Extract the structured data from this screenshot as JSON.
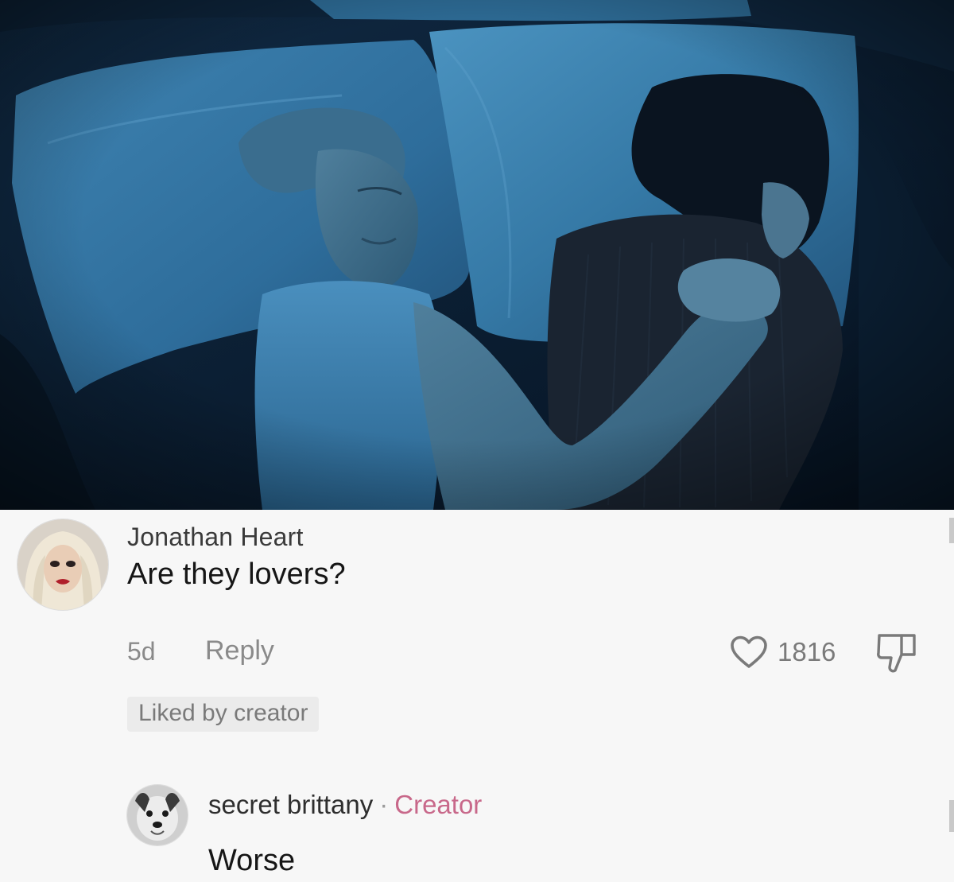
{
  "photo": {
    "description_icon": "bedroom-photo"
  },
  "comment": {
    "username": "Jonathan Heart",
    "text": "Are they lovers?",
    "time": "5d",
    "reply_label": "Reply",
    "like_count": "1816",
    "liked_badge": "Liked by creator",
    "like_icon": "heart-outline-icon",
    "dislike_icon": "thumbs-down-icon"
  },
  "reply": {
    "username": "secret brittany",
    "separator": "·",
    "creator_tag": "Creator",
    "text": "Worse"
  },
  "colors": {
    "creator_accent": "#c8688a",
    "muted_text": "#8a8a8a",
    "badge_bg": "#ebebeb"
  }
}
